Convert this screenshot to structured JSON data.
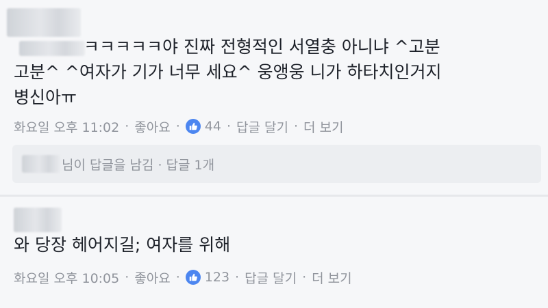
{
  "comments": [
    {
      "lines": [
        "ㅋㅋㅋㅋㅋ야 진짜 전형적인 서열충 아니냐 ^고분",
        "고분^ ^여자가 기가 너무 세요^ 웅앵웅 니가 하타치인거지",
        "병신아ㅠ"
      ],
      "time": "화요일 오후 11:02",
      "like_label": "좋아요",
      "like_count": "44",
      "reply_label": "답글 달기",
      "more_label": "더 보기",
      "reply_summary": {
        "text": "님이 답글을 남김",
        "count": "답글 1개"
      }
    },
    {
      "lines": [
        "와 당장 헤어지길; 여자를 위해"
      ],
      "time": "화요일 오후 10:05",
      "like_label": "좋아요",
      "like_count": "123",
      "reply_label": "답글 달기",
      "more_label": "더 보기"
    }
  ],
  "separator": "·",
  "colors": {
    "accent": "#4c86f0",
    "meta": "#90949c",
    "text": "#1d2129",
    "background": "#f6f7f9"
  }
}
